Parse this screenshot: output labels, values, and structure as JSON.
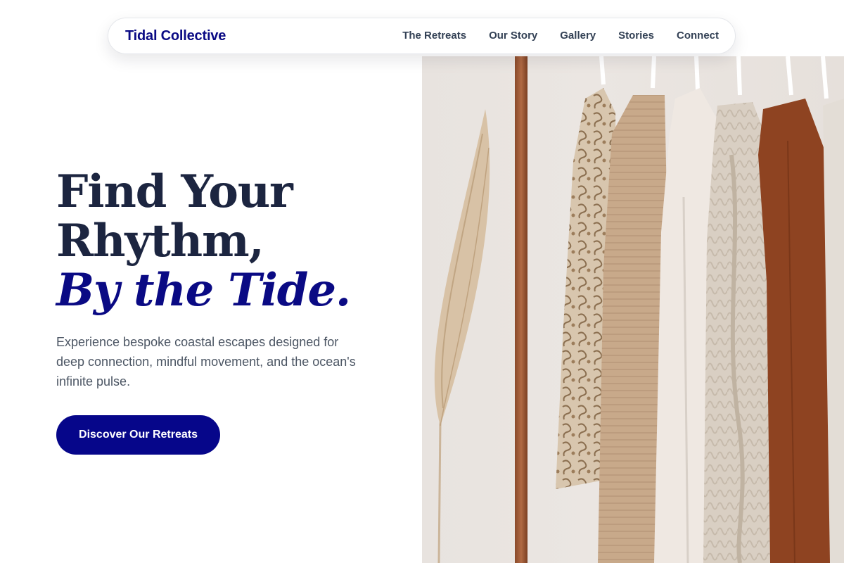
{
  "nav": {
    "brand": "Tidal Collective",
    "links": [
      "The Retreats",
      "Our Story",
      "Gallery",
      "Stories",
      "Connect"
    ]
  },
  "hero": {
    "headline_line1": "Find Your",
    "headline_line2": "Rhythm,",
    "headline_accent": "By the Tide.",
    "subtext": "Experience bespoke coastal escapes designed for deep connection, mindful movement, and the ocean's infinite pulse.",
    "cta_label": "Discover Our Retreats",
    "image_alt": "Knit sweaters hanging on a rack beside dried pampas grass"
  },
  "colors": {
    "brand": "#0a0a84",
    "cta_background": "#06068a",
    "headline": "#1c2540",
    "body_text": "#4b5563"
  }
}
